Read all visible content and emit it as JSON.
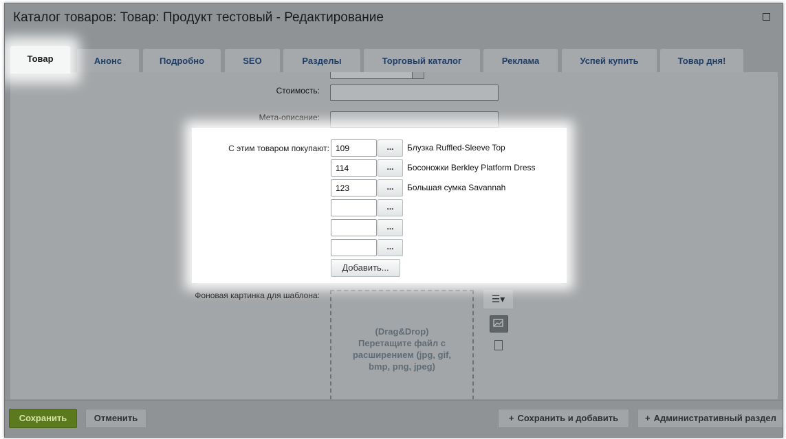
{
  "window": {
    "title": "Каталог товаров: Товар: Продукт тестовый - Редактирование"
  },
  "tabs": [
    {
      "label": "Товар",
      "active": true
    },
    {
      "label": "Анонс"
    },
    {
      "label": "Подробно"
    },
    {
      "label": "SEO"
    },
    {
      "label": "Разделы"
    },
    {
      "label": "Торговый каталог"
    },
    {
      "label": "Реклама"
    },
    {
      "label": "Успей купить"
    },
    {
      "label": "Товар дня!"
    }
  ],
  "form": {
    "cost_label": "Стоимость:",
    "meta_label": "Мета-описание:",
    "related": {
      "label": "С этим товаром покупают:",
      "items": [
        {
          "id": "109",
          "name": "Блузка Ruffled-Sleeve Top"
        },
        {
          "id": "114",
          "name": "Босоножки Berkley Platform Dress"
        },
        {
          "id": "123",
          "name": "Большая сумка Savannah"
        },
        {
          "id": "",
          "name": ""
        },
        {
          "id": "",
          "name": ""
        },
        {
          "id": "",
          "name": ""
        }
      ],
      "dots_label": "...",
      "add_label": "Добавить..."
    },
    "background": {
      "label": "Фоновая картинка для шаблона:",
      "drop_line1": "(Drag&Drop)",
      "drop_line2": "Перетащите файл с",
      "drop_line3": "расширением (jpg, gif,",
      "drop_line4": "bmp, png, jpeg)"
    }
  },
  "footer": {
    "save": "Сохранить",
    "cancel": "Отменить",
    "save_add": "Сохранить и добавить",
    "admin": "Административный раздел"
  },
  "colors": {
    "save_button": "#5a7a1d",
    "tab_text": "#1f3e66"
  }
}
